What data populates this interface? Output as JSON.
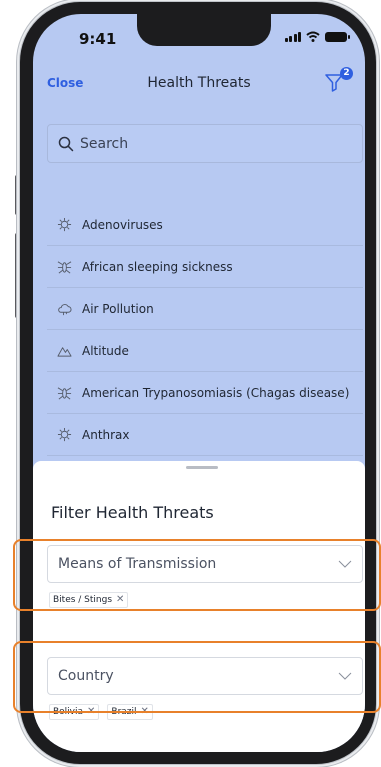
{
  "status_bar": {
    "time": "9:41"
  },
  "nav": {
    "close_label": "Close",
    "title": "Health Threats",
    "filter_badge_count": "2"
  },
  "search": {
    "placeholder": "Search"
  },
  "threats": [
    {
      "label": "Adenoviruses",
      "icon": "virus-icon"
    },
    {
      "label": "African sleeping sickness",
      "icon": "insect-icon"
    },
    {
      "label": "Air Pollution",
      "icon": "cloud-icon"
    },
    {
      "label": "Altitude",
      "icon": "mountain-icon"
    },
    {
      "label": "American Trypanosomiasis (Chagas disease)",
      "icon": "insect-icon"
    },
    {
      "label": "Anthrax",
      "icon": "virus-icon"
    }
  ],
  "filter_sheet": {
    "title": "Filter Health Threats",
    "transmission": {
      "label": "Means of Transmission",
      "chips": [
        "Bites / Stings"
      ]
    },
    "country": {
      "label": "Country",
      "chips": [
        "Bolivia",
        "Brazil"
      ]
    }
  },
  "colors": {
    "accent": "#2f5fe0",
    "screen_background": "#b7c9f2",
    "highlight": "#e8812b"
  }
}
